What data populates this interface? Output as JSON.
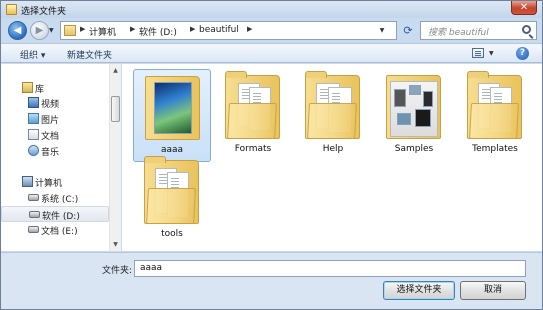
{
  "window": {
    "title": "选择文件夹",
    "close_label": "✕"
  },
  "address": {
    "crumbs": [
      "计算机",
      "软件 (D:)",
      "beautiful"
    ],
    "search_placeholder": "搜索 beautiful"
  },
  "toolbar": {
    "organize_label": "组织 ▾",
    "new_folder_label": "新建文件夹",
    "help_label": "?"
  },
  "navpane": {
    "libraries": {
      "label": "库",
      "items": [
        "视频",
        "图片",
        "文档",
        "音乐"
      ]
    },
    "computer": {
      "label": "计算机",
      "items": [
        "系统 (C:)",
        "软件 (D:)",
        "文档 (E:)"
      ]
    },
    "selected_item": "软件 (D:)"
  },
  "content": {
    "folders": [
      "aaaa",
      "Formats",
      "Help",
      "Samples",
      "Templates",
      "tools"
    ],
    "selected_folder": "aaaa"
  },
  "footer": {
    "filename_label": "文件夹:",
    "filename_value": "aaaa",
    "select_button": "选择文件夹",
    "cancel_button": "取消"
  },
  "colors": {
    "accent": "#2a6fc0",
    "selection": "#c9e0f7",
    "folder": "#f5d886",
    "close": "#c3432b"
  }
}
